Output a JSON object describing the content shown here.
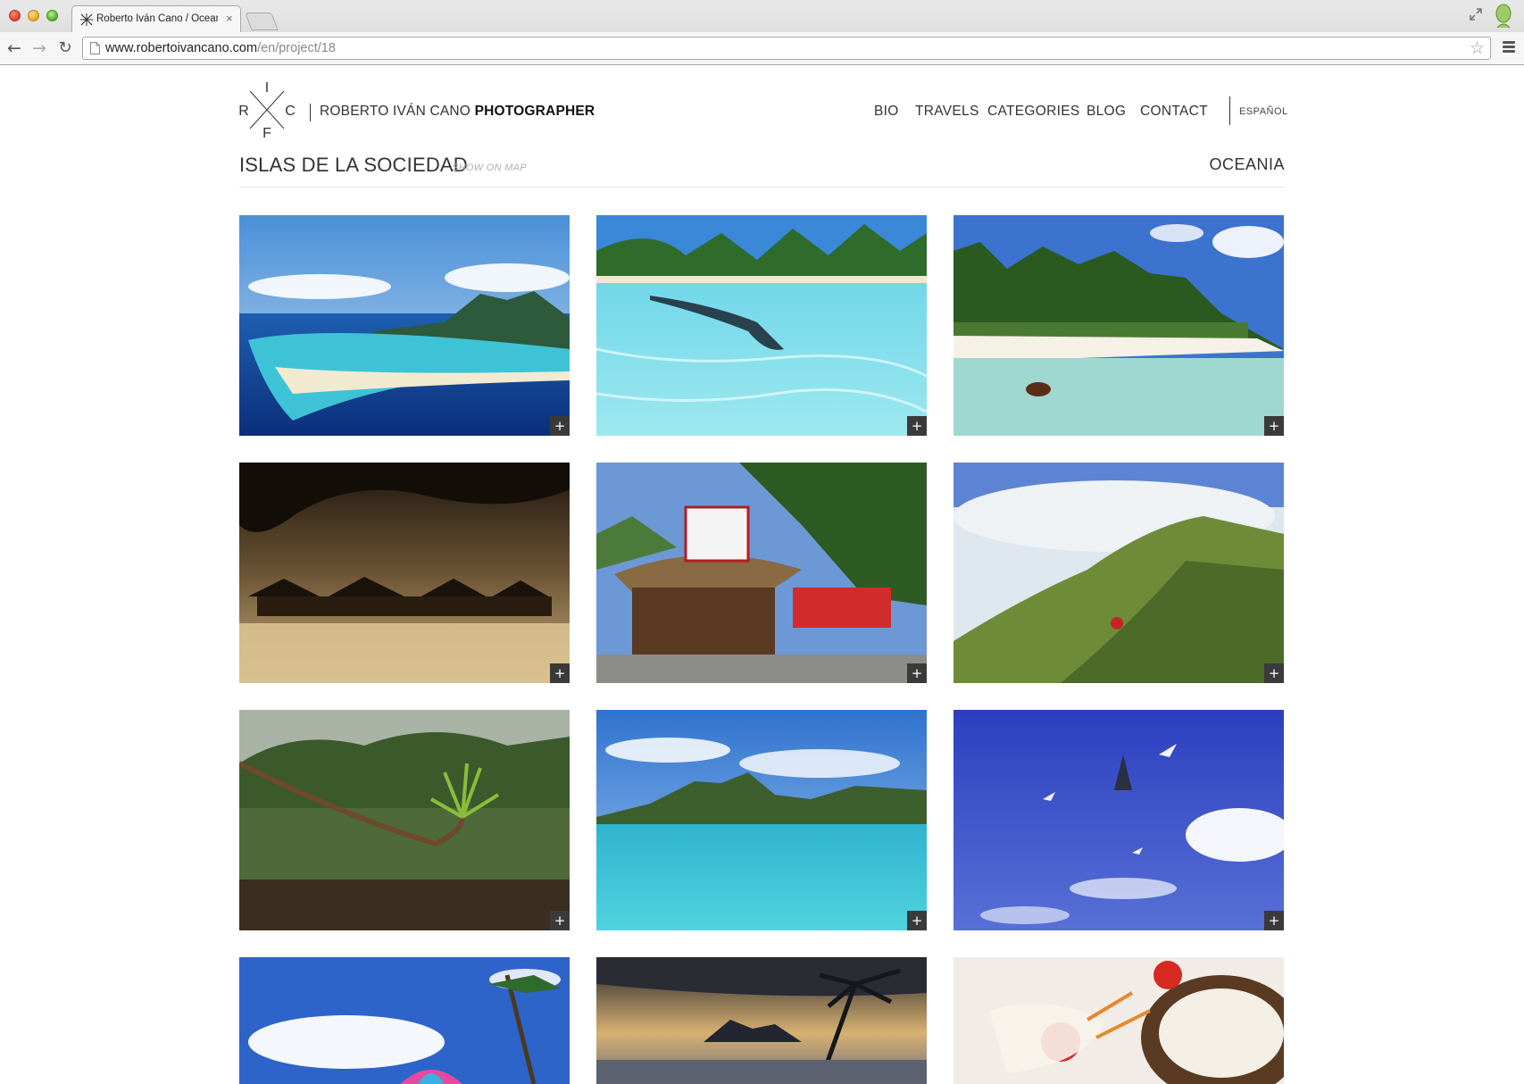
{
  "browser": {
    "tab_title": "Roberto Iván Cano / Oceania",
    "url_host": "www.robertoivancano.com",
    "url_path": "/en/project/18"
  },
  "site": {
    "logo_letters": {
      "top": "I",
      "left": "R",
      "right": "C",
      "bottom": "F"
    },
    "logo_name": "ROBERTO IVÁN CANO",
    "logo_role": "PHOTOGRAPHER",
    "nav": [
      "BIO",
      "TRAVELS",
      "CATEGORIES",
      "BLOG",
      "CONTACT"
    ],
    "language_link": "ESPAÑOL"
  },
  "project": {
    "title": "ISLAS DE LA SOCIEDAD",
    "show_on_map": "SHOW ON MAP",
    "region": "OCEANIA"
  },
  "gallery": {
    "expand_label": "+",
    "photos": [
      "bora-bora-aerial",
      "swimmer-in-lagoon",
      "beach-with-dog",
      "overwater-bungalows-sunset",
      "tiki-souvenir-shop",
      "misty-mountain-hiker",
      "jungle-pandanus",
      "mount-otemanu-lagoon",
      "birds-blue-sky",
      "beach-umbrellas",
      "sunset-palms",
      "poisson-cru-coconut"
    ]
  },
  "colors": {
    "text": "#333333",
    "rule": "#e6e6e6",
    "expand_button": "#3a3a3a"
  }
}
